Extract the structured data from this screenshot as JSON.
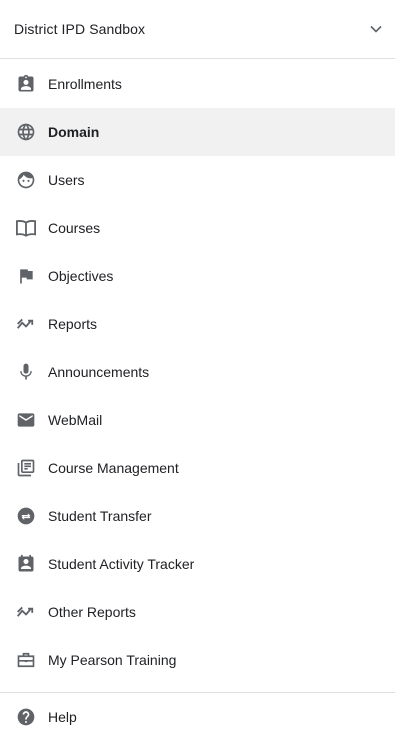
{
  "header": {
    "title": "District IPD Sandbox",
    "dropdown_icon": "chevron-down-icon"
  },
  "nav": {
    "items": [
      {
        "label": "Enrollments",
        "icon": "enrollment-badge-icon",
        "active": false
      },
      {
        "label": "Domain",
        "icon": "globe-icon",
        "active": true
      },
      {
        "label": "Users",
        "icon": "face-icon",
        "active": false
      },
      {
        "label": "Courses",
        "icon": "open-book-icon",
        "active": false
      },
      {
        "label": "Objectives",
        "icon": "flag-icon",
        "active": false
      },
      {
        "label": "Reports",
        "icon": "trending-icon",
        "active": false
      },
      {
        "label": "Announcements",
        "icon": "microphone-icon",
        "active": false
      },
      {
        "label": "WebMail",
        "icon": "mail-icon",
        "active": false
      },
      {
        "label": "Course Management",
        "icon": "library-books-icon",
        "active": false
      },
      {
        "label": "Student Transfer",
        "icon": "transfer-icon",
        "active": false
      },
      {
        "label": "Student Activity Tracker",
        "icon": "calendar-person-icon",
        "active": false
      },
      {
        "label": "Other Reports",
        "icon": "trending-icon",
        "active": false
      },
      {
        "label": "My Pearson Training",
        "icon": "briefcase-icon",
        "active": false
      }
    ]
  },
  "footer": {
    "help_label": "Help",
    "help_icon": "help-circle-icon"
  },
  "colors": {
    "icon": "#5f6368",
    "active_background": "#f1f1f1",
    "divider": "#e0e0e0",
    "text": "#202124"
  }
}
